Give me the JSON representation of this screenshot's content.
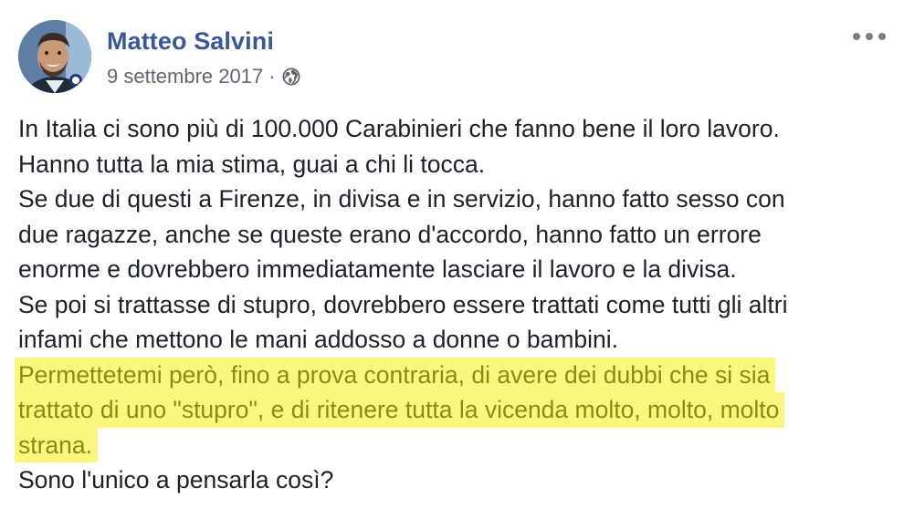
{
  "post": {
    "author": "Matteo Salvini",
    "date": "9 settembre 2017",
    "separator": "·",
    "privacy_icon": "globe-icon",
    "more_icon": "more-options-icon",
    "paragraphs": [
      "In Italia ci sono più di 100.000 Carabinieri che fanno bene il loro lavoro.",
      "Hanno tutta la mia stima, guai a chi li tocca.",
      "Se due di questi a Firenze, in divisa e in servizio, hanno fatto sesso con",
      "due ragazze, anche se queste erano d'accordo, hanno fatto un errore",
      "enorme e dovrebbero immediatamente lasciare il lavoro e la divisa.",
      "Se poi si trattasse di stupro, dovrebbero essere trattati come tutti gli altri",
      "infami che mettono le mani addosso a donne o bambini."
    ],
    "highlighted": [
      "Permettetemi però, fino a prova contraria, di avere dei dubbi che si sia",
      "trattato di uno \"stupro\", e di ritenere tutta la vicenda molto, molto, molto",
      "strana."
    ],
    "closing": "Sono l'unico a pensarla così?"
  },
  "colors": {
    "author": "#385898",
    "meta": "#606770",
    "text": "#1d2129",
    "highlight_bg": "#fbf67f",
    "highlight_text": "#8a8c12"
  }
}
